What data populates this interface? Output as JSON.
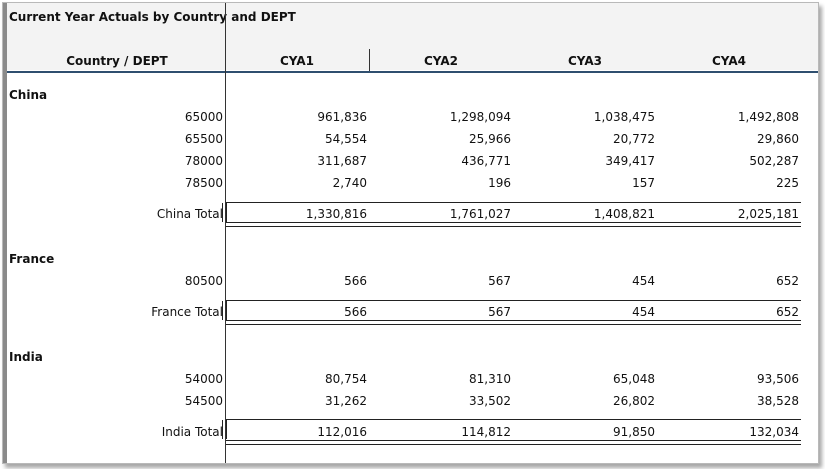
{
  "report": {
    "title": "Current Year Actuals by Country and DEPT",
    "row_header": "Country / DEPT",
    "columns": [
      "CYA1",
      "CYA2",
      "CYA3",
      "CYA4"
    ]
  },
  "groups": [
    {
      "country": "China",
      "rows": [
        {
          "dept": "65000",
          "values": [
            "961,836",
            "1,298,094",
            "1,038,475",
            "1,492,808"
          ]
        },
        {
          "dept": "65500",
          "values": [
            "54,554",
            "25,966",
            "20,772",
            "29,860"
          ]
        },
        {
          "dept": "78000",
          "values": [
            "311,687",
            "436,771",
            "349,417",
            "502,287"
          ]
        },
        {
          "dept": "78500",
          "values": [
            "2,740",
            "196",
            "157",
            "225"
          ]
        }
      ],
      "total": {
        "label": "China Total",
        "values": [
          "1,330,816",
          "1,761,027",
          "1,408,821",
          "2,025,181"
        ]
      }
    },
    {
      "country": "France",
      "rows": [
        {
          "dept": "80500",
          "values": [
            "566",
            "567",
            "454",
            "652"
          ]
        }
      ],
      "total": {
        "label": "France Total",
        "values": [
          "566",
          "567",
          "454",
          "652"
        ]
      }
    },
    {
      "country": "India",
      "rows": [
        {
          "dept": "54000",
          "values": [
            "80,754",
            "81,310",
            "65,048",
            "93,506"
          ]
        },
        {
          "dept": "54500",
          "values": [
            "31,262",
            "33,502",
            "26,802",
            "38,528"
          ]
        }
      ],
      "total": {
        "label": "India Total",
        "values": [
          "112,016",
          "114,812",
          "91,850",
          "132,034"
        ]
      }
    }
  ]
}
